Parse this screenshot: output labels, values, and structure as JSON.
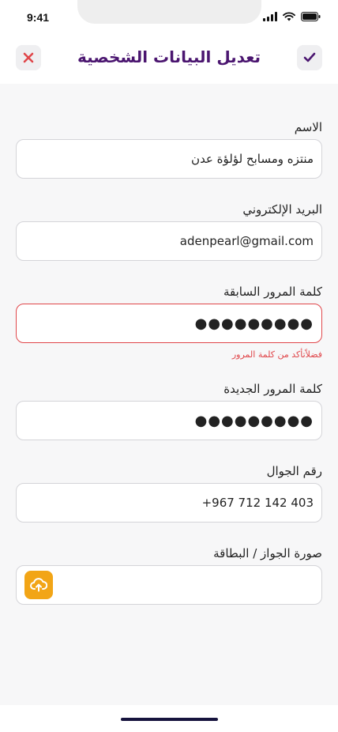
{
  "status_bar": {
    "time": "9:41"
  },
  "header": {
    "title": "تعديل البيانات الشخصية",
    "close_icon": "close-icon",
    "confirm_icon": "check-icon"
  },
  "form": {
    "name": {
      "label": "الاسم",
      "value": "منتزه ومسابح لؤلؤة عدن"
    },
    "email": {
      "label": "البريد الإلكتروني",
      "value": "adenpearl@gmail.com"
    },
    "old_password": {
      "label": "كلمة المرور السابقة",
      "value": "●●●●●●●●●",
      "error": "فضلاًتأكد من كلمة المرور"
    },
    "new_password": {
      "label": "كلمة المرور الجديدة",
      "value": "●●●●●●●●●"
    },
    "phone": {
      "label": "رقم الجوال",
      "value": "+967 712 142 403"
    },
    "id_photo": {
      "label": "صورة الجواز / البطاقة",
      "upload_icon": "upload-cloud-icon"
    }
  },
  "colors": {
    "title": "#4b1670",
    "close": "#e0464a",
    "confirm": "#4b1670",
    "error": "#e0464a",
    "upload_button": "#f2a516"
  }
}
